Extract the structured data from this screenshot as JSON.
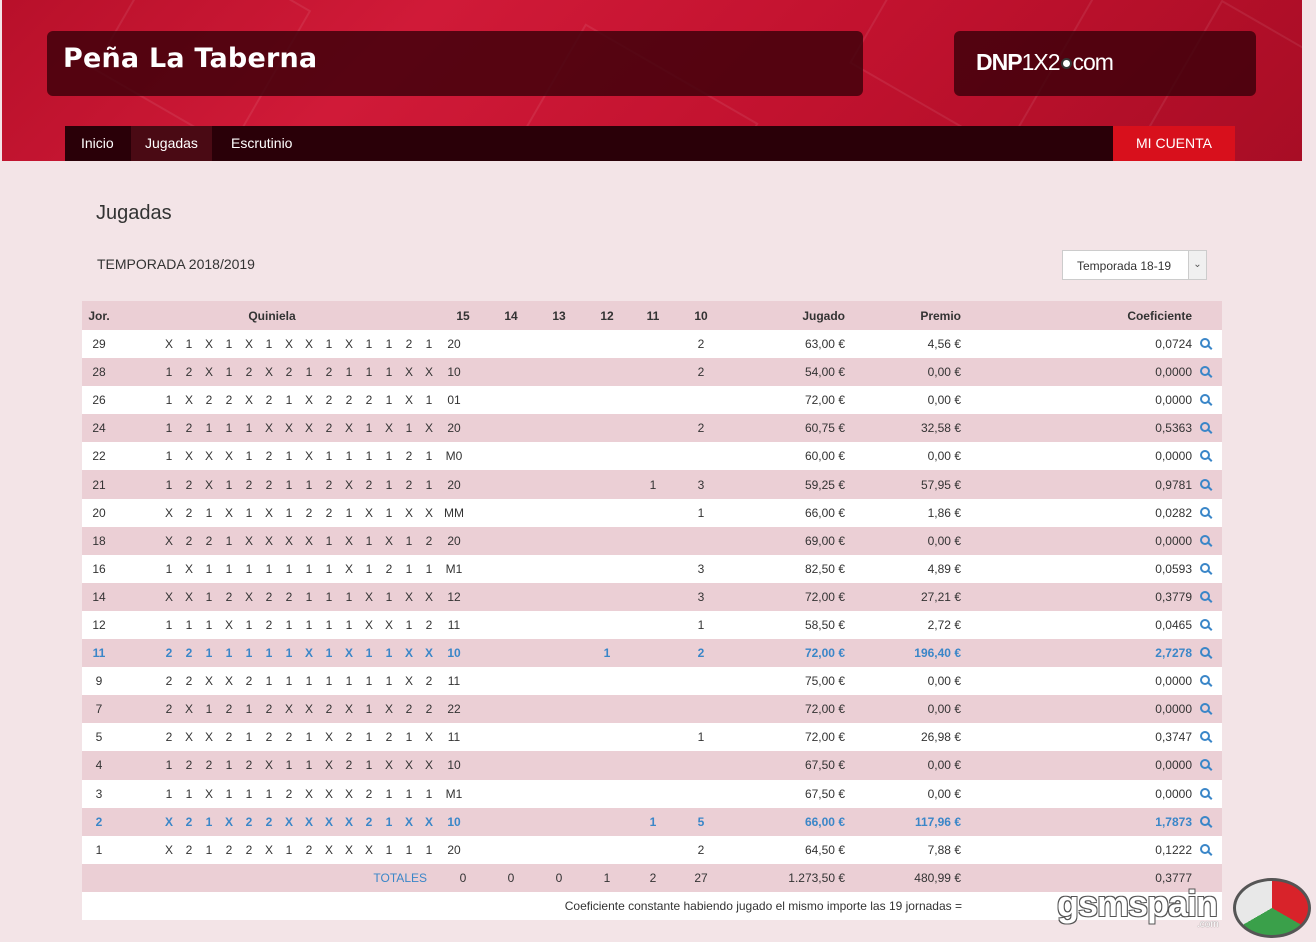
{
  "header": {
    "title": "Peña La Taberna",
    "logo": {
      "brand": "DNP",
      "mid": "1X2",
      "tld": "com"
    }
  },
  "nav": {
    "items": [
      {
        "label": "Inicio"
      },
      {
        "label": "Jugadas"
      },
      {
        "label": "Escrutinio"
      }
    ],
    "account_label": "MI CUENTA"
  },
  "page": {
    "title": "Jugadas",
    "season_label": "TEMPORADA 2018/2019",
    "season_select": "Temporada 18-19"
  },
  "table": {
    "headers": {
      "jor": "Jor.",
      "quiniela": "Quiniela",
      "h15": "15",
      "h14": "14",
      "h13": "13",
      "h12": "12",
      "h11": "11",
      "h10": "10",
      "jugado": "Jugado",
      "premio": "Premio",
      "coef": "Coeficiente"
    },
    "rows": [
      {
        "jor": "29",
        "q": [
          "X",
          "1",
          "X",
          "1",
          "X",
          "1",
          "X",
          "X",
          "1",
          "X",
          "1",
          "1",
          "2",
          "1",
          "20"
        ],
        "h15": "",
        "h14": "",
        "h13": "",
        "h12": "",
        "h11": "",
        "h10": "2",
        "jugado": "63,00 €",
        "premio": "4,56 €",
        "coef": "0,0724",
        "hl": false
      },
      {
        "jor": "28",
        "q": [
          "1",
          "2",
          "X",
          "1",
          "2",
          "X",
          "2",
          "1",
          "2",
          "1",
          "1",
          "1",
          "X",
          "X",
          "10"
        ],
        "h15": "",
        "h14": "",
        "h13": "",
        "h12": "",
        "h11": "",
        "h10": "2",
        "jugado": "54,00 €",
        "premio": "0,00 €",
        "coef": "0,0000",
        "hl": false
      },
      {
        "jor": "26",
        "q": [
          "1",
          "X",
          "2",
          "2",
          "X",
          "2",
          "1",
          "X",
          "2",
          "2",
          "2",
          "1",
          "X",
          "1",
          "01"
        ],
        "h15": "",
        "h14": "",
        "h13": "",
        "h12": "",
        "h11": "",
        "h10": "",
        "jugado": "72,00 €",
        "premio": "0,00 €",
        "coef": "0,0000",
        "hl": false
      },
      {
        "jor": "24",
        "q": [
          "1",
          "2",
          "1",
          "1",
          "1",
          "X",
          "X",
          "X",
          "2",
          "X",
          "1",
          "X",
          "1",
          "X",
          "20"
        ],
        "h15": "",
        "h14": "",
        "h13": "",
        "h12": "",
        "h11": "",
        "h10": "2",
        "jugado": "60,75 €",
        "premio": "32,58 €",
        "coef": "0,5363",
        "hl": false
      },
      {
        "jor": "22",
        "q": [
          "1",
          "X",
          "X",
          "X",
          "1",
          "2",
          "1",
          "X",
          "1",
          "1",
          "1",
          "1",
          "2",
          "1",
          "M0"
        ],
        "h15": "",
        "h14": "",
        "h13": "",
        "h12": "",
        "h11": "",
        "h10": "",
        "jugado": "60,00 €",
        "premio": "0,00 €",
        "coef": "0,0000",
        "hl": false
      },
      {
        "jor": "21",
        "q": [
          "1",
          "2",
          "X",
          "1",
          "2",
          "2",
          "1",
          "1",
          "2",
          "X",
          "2",
          "1",
          "2",
          "1",
          "20"
        ],
        "h15": "",
        "h14": "",
        "h13": "",
        "h12": "",
        "h11": "1",
        "h10": "3",
        "jugado": "59,25 €",
        "premio": "57,95 €",
        "coef": "0,9781",
        "hl": false
      },
      {
        "jor": "20",
        "q": [
          "X",
          "2",
          "1",
          "X",
          "1",
          "X",
          "1",
          "2",
          "2",
          "1",
          "X",
          "1",
          "X",
          "X",
          "MM"
        ],
        "h15": "",
        "h14": "",
        "h13": "",
        "h12": "",
        "h11": "",
        "h10": "1",
        "jugado": "66,00 €",
        "premio": "1,86 €",
        "coef": "0,0282",
        "hl": false
      },
      {
        "jor": "18",
        "q": [
          "X",
          "2",
          "2",
          "1",
          "X",
          "X",
          "X",
          "X",
          "1",
          "X",
          "1",
          "X",
          "1",
          "2",
          "20"
        ],
        "h15": "",
        "h14": "",
        "h13": "",
        "h12": "",
        "h11": "",
        "h10": "",
        "jugado": "69,00 €",
        "premio": "0,00 €",
        "coef": "0,0000",
        "hl": false
      },
      {
        "jor": "16",
        "q": [
          "1",
          "X",
          "1",
          "1",
          "1",
          "1",
          "1",
          "1",
          "1",
          "X",
          "1",
          "2",
          "1",
          "1",
          "M1"
        ],
        "h15": "",
        "h14": "",
        "h13": "",
        "h12": "",
        "h11": "",
        "h10": "3",
        "jugado": "82,50 €",
        "premio": "4,89 €",
        "coef": "0,0593",
        "hl": false
      },
      {
        "jor": "14",
        "q": [
          "X",
          "X",
          "1",
          "2",
          "X",
          "2",
          "2",
          "1",
          "1",
          "1",
          "X",
          "1",
          "X",
          "X",
          "12"
        ],
        "h15": "",
        "h14": "",
        "h13": "",
        "h12": "",
        "h11": "",
        "h10": "3",
        "jugado": "72,00 €",
        "premio": "27,21 €",
        "coef": "0,3779",
        "hl": false
      },
      {
        "jor": "12",
        "q": [
          "1",
          "1",
          "1",
          "X",
          "1",
          "2",
          "1",
          "1",
          "1",
          "1",
          "X",
          "X",
          "1",
          "2",
          "11"
        ],
        "h15": "",
        "h14": "",
        "h13": "",
        "h12": "",
        "h11": "",
        "h10": "1",
        "jugado": "58,50 €",
        "premio": "2,72 €",
        "coef": "0,0465",
        "hl": false
      },
      {
        "jor": "11",
        "q": [
          "2",
          "2",
          "1",
          "1",
          "1",
          "1",
          "1",
          "X",
          "1",
          "X",
          "1",
          "1",
          "X",
          "X",
          "10"
        ],
        "h15": "",
        "h14": "",
        "h13": "",
        "h12": "1",
        "h11": "",
        "h10": "2",
        "jugado": "72,00 €",
        "premio": "196,40 €",
        "coef": "2,7278",
        "hl": true
      },
      {
        "jor": "9",
        "q": [
          "2",
          "2",
          "X",
          "X",
          "2",
          "1",
          "1",
          "1",
          "1",
          "1",
          "1",
          "1",
          "X",
          "2",
          "11"
        ],
        "h15": "",
        "h14": "",
        "h13": "",
        "h12": "",
        "h11": "",
        "h10": "",
        "jugado": "75,00 €",
        "premio": "0,00 €",
        "coef": "0,0000",
        "hl": false
      },
      {
        "jor": "7",
        "q": [
          "2",
          "X",
          "1",
          "2",
          "1",
          "2",
          "X",
          "X",
          "2",
          "X",
          "1",
          "X",
          "2",
          "2",
          "22"
        ],
        "h15": "",
        "h14": "",
        "h13": "",
        "h12": "",
        "h11": "",
        "h10": "",
        "jugado": "72,00 €",
        "premio": "0,00 €",
        "coef": "0,0000",
        "hl": false
      },
      {
        "jor": "5",
        "q": [
          "2",
          "X",
          "X",
          "2",
          "1",
          "2",
          "2",
          "1",
          "X",
          "2",
          "1",
          "2",
          "1",
          "X",
          "11"
        ],
        "h15": "",
        "h14": "",
        "h13": "",
        "h12": "",
        "h11": "",
        "h10": "1",
        "jugado": "72,00 €",
        "premio": "26,98 €",
        "coef": "0,3747",
        "hl": false
      },
      {
        "jor": "4",
        "q": [
          "1",
          "2",
          "2",
          "1",
          "2",
          "X",
          "1",
          "1",
          "X",
          "2",
          "1",
          "X",
          "X",
          "X",
          "10"
        ],
        "h15": "",
        "h14": "",
        "h13": "",
        "h12": "",
        "h11": "",
        "h10": "",
        "jugado": "67,50 €",
        "premio": "0,00 €",
        "coef": "0,0000",
        "hl": false
      },
      {
        "jor": "3",
        "q": [
          "1",
          "1",
          "X",
          "1",
          "1",
          "1",
          "2",
          "X",
          "X",
          "X",
          "2",
          "1",
          "1",
          "1",
          "M1"
        ],
        "h15": "",
        "h14": "",
        "h13": "",
        "h12": "",
        "h11": "",
        "h10": "",
        "jugado": "67,50 €",
        "premio": "0,00 €",
        "coef": "0,0000",
        "hl": false
      },
      {
        "jor": "2",
        "q": [
          "X",
          "2",
          "1",
          "X",
          "2",
          "2",
          "X",
          "X",
          "X",
          "X",
          "2",
          "1",
          "X",
          "X",
          "10"
        ],
        "h15": "",
        "h14": "",
        "h13": "",
        "h12": "",
        "h11": "1",
        "h10": "5",
        "jugado": "66,00 €",
        "premio": "117,96 €",
        "coef": "1,7873",
        "hl": true
      },
      {
        "jor": "1",
        "q": [
          "X",
          "2",
          "1",
          "2",
          "2",
          "X",
          "1",
          "2",
          "X",
          "X",
          "X",
          "1",
          "1",
          "1",
          "20"
        ],
        "h15": "",
        "h14": "",
        "h13": "",
        "h12": "",
        "h11": "",
        "h10": "2",
        "jugado": "64,50 €",
        "premio": "7,88 €",
        "coef": "0,1222",
        "hl": false
      }
    ],
    "totals": {
      "label": "TOTALES",
      "h15": "0",
      "h14": "0",
      "h13": "0",
      "h12": "1",
      "h11": "2",
      "h10": "27",
      "jugado": "1.273,50 €",
      "premio": "480,99 €",
      "coef": "0,3777"
    },
    "footer": "Coeficiente constante habiendo jugado el mismo importe las 19 jornadas ="
  },
  "watermark": {
    "text": "gsmspain",
    "tld": ".com"
  }
}
